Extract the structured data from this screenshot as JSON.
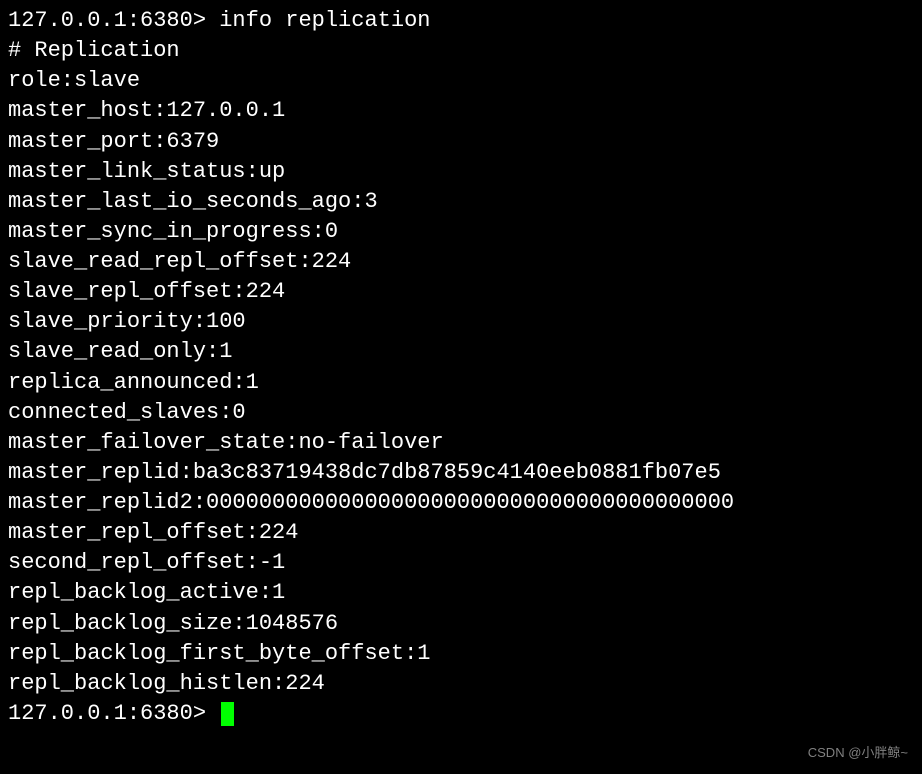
{
  "terminal": {
    "prompt1": "127.0.0.1:6380> ",
    "command": "info replication",
    "header": "# Replication",
    "lines": [
      "role:slave",
      "master_host:127.0.0.1",
      "master_port:6379",
      "master_link_status:up",
      "master_last_io_seconds_ago:3",
      "master_sync_in_progress:0",
      "slave_read_repl_offset:224",
      "slave_repl_offset:224",
      "slave_priority:100",
      "slave_read_only:1",
      "replica_announced:1",
      "connected_slaves:0",
      "master_failover_state:no-failover",
      "master_replid:ba3c83719438dc7db87859c4140eeb0881fb07e5",
      "master_replid2:0000000000000000000000000000000000000000",
      "master_repl_offset:224",
      "second_repl_offset:-1",
      "repl_backlog_active:1",
      "repl_backlog_size:1048576",
      "repl_backlog_first_byte_offset:1",
      "repl_backlog_histlen:224"
    ],
    "prompt2": "127.0.0.1:6380> "
  },
  "watermark": "CSDN @小胖鲸~"
}
